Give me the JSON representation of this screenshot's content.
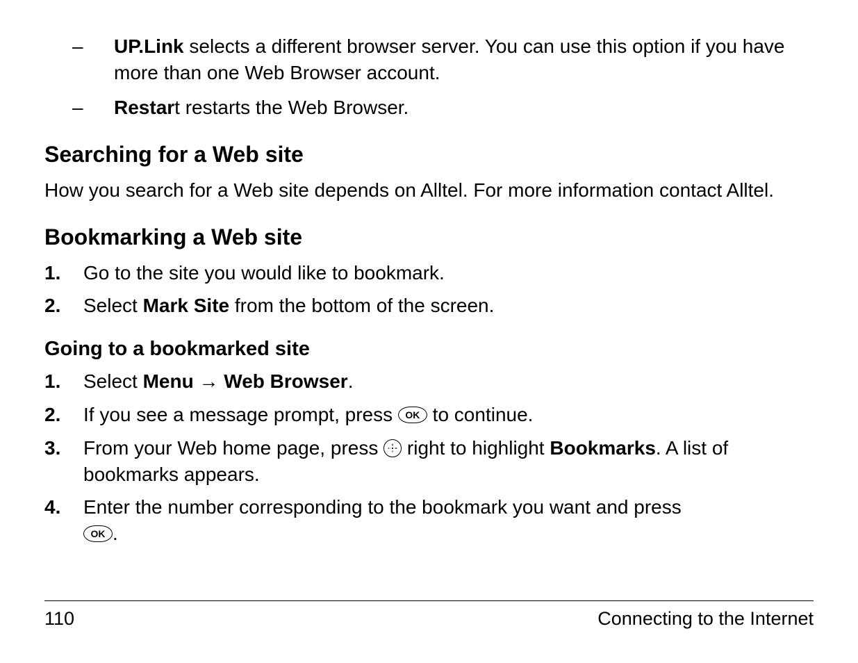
{
  "bullets": {
    "uplink": {
      "bold": "UP.Link",
      "rest": " selects a different browser server. You can use this option if you have more than one Web Browser account."
    },
    "restart": {
      "bold": "Restar",
      "rest": "t restarts the Web Browser."
    }
  },
  "searching": {
    "heading": "Searching for a Web site",
    "para": "How you search for a Web site depends on Alltel. For more information contact Alltel."
  },
  "bookmarking": {
    "heading": "Bookmarking a Web site",
    "step1": "Go to the site you would like to bookmark.",
    "step2_pre": "Select ",
    "step2_bold": "Mark Site",
    "step2_post": " from the bottom of the screen."
  },
  "going": {
    "heading": "Going to a bookmarked site",
    "step1_pre": "Select ",
    "step1_menu": "Menu",
    "step1_arrow": " → ",
    "step1_web": "Web Browser",
    "step1_post": ".",
    "step2_pre": "If you see a message prompt, press ",
    "step2_post": " to continue.",
    "step3_pre": "From your Web home page, press ",
    "step3_mid": " right to highlight ",
    "step3_bold": "Bookmarks",
    "step3_post": ". A list of bookmarks appears.",
    "step4_pre": "Enter the number corresponding to the bookmark you want and press ",
    "step4_post": "."
  },
  "ok_label": "OK",
  "nums": {
    "n1": "1.",
    "n2": "2.",
    "n3": "3.",
    "n4": "4."
  },
  "dash": "–",
  "footer": {
    "page": "110",
    "title": "Connecting to the Internet"
  }
}
